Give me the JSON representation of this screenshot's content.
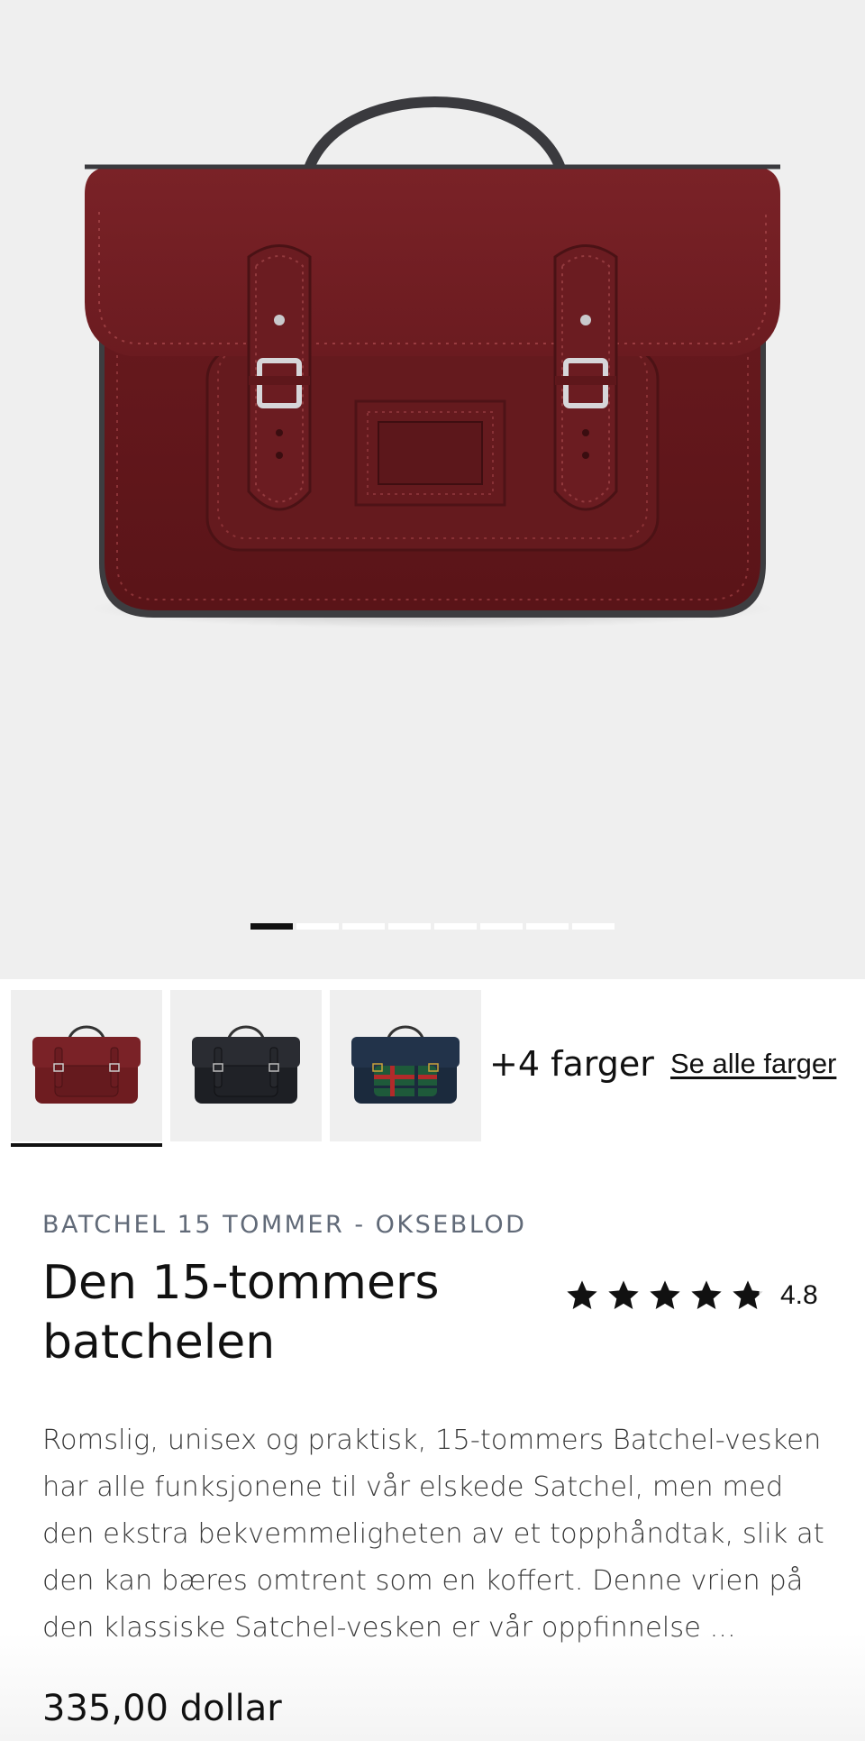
{
  "gallery": {
    "image_alt": "Batchel 15 tommer - Okseblod",
    "slide_count": 8,
    "active_slide": 1
  },
  "colors": {
    "swatches": [
      {
        "name": "okseblod",
        "bag_color": "#6e1c20",
        "active": true
      },
      {
        "name": "svart",
        "bag_color": "#1d1f24",
        "active": false
      },
      {
        "name": "tartan",
        "bag_color": "#1b2a3d",
        "active": false
      }
    ],
    "more_label": "+4 farger",
    "see_all_label": "Se alle farger"
  },
  "product": {
    "eyebrow": "BATCHEL 15 TOMMER - OKSEBLOD",
    "title": "Den 15-tommers batchelen",
    "rating_value": "4.8",
    "rating": 4.8,
    "description": "Romslig, unisex og praktisk, 15-tommers Batchel-vesken har alle funksjonene til vår elskede Satchel, men med den ekstra bekvemmeligheten av et topphåndtak, slik at den kan bæres omtrent som en koffert. Denne vrien på den klassiske Satchel-vesken er vår oppfinnelse ...",
    "price": "335,00 dollar"
  },
  "theme": {
    "accent": "#111111",
    "bag_main": "#6e1c20"
  }
}
